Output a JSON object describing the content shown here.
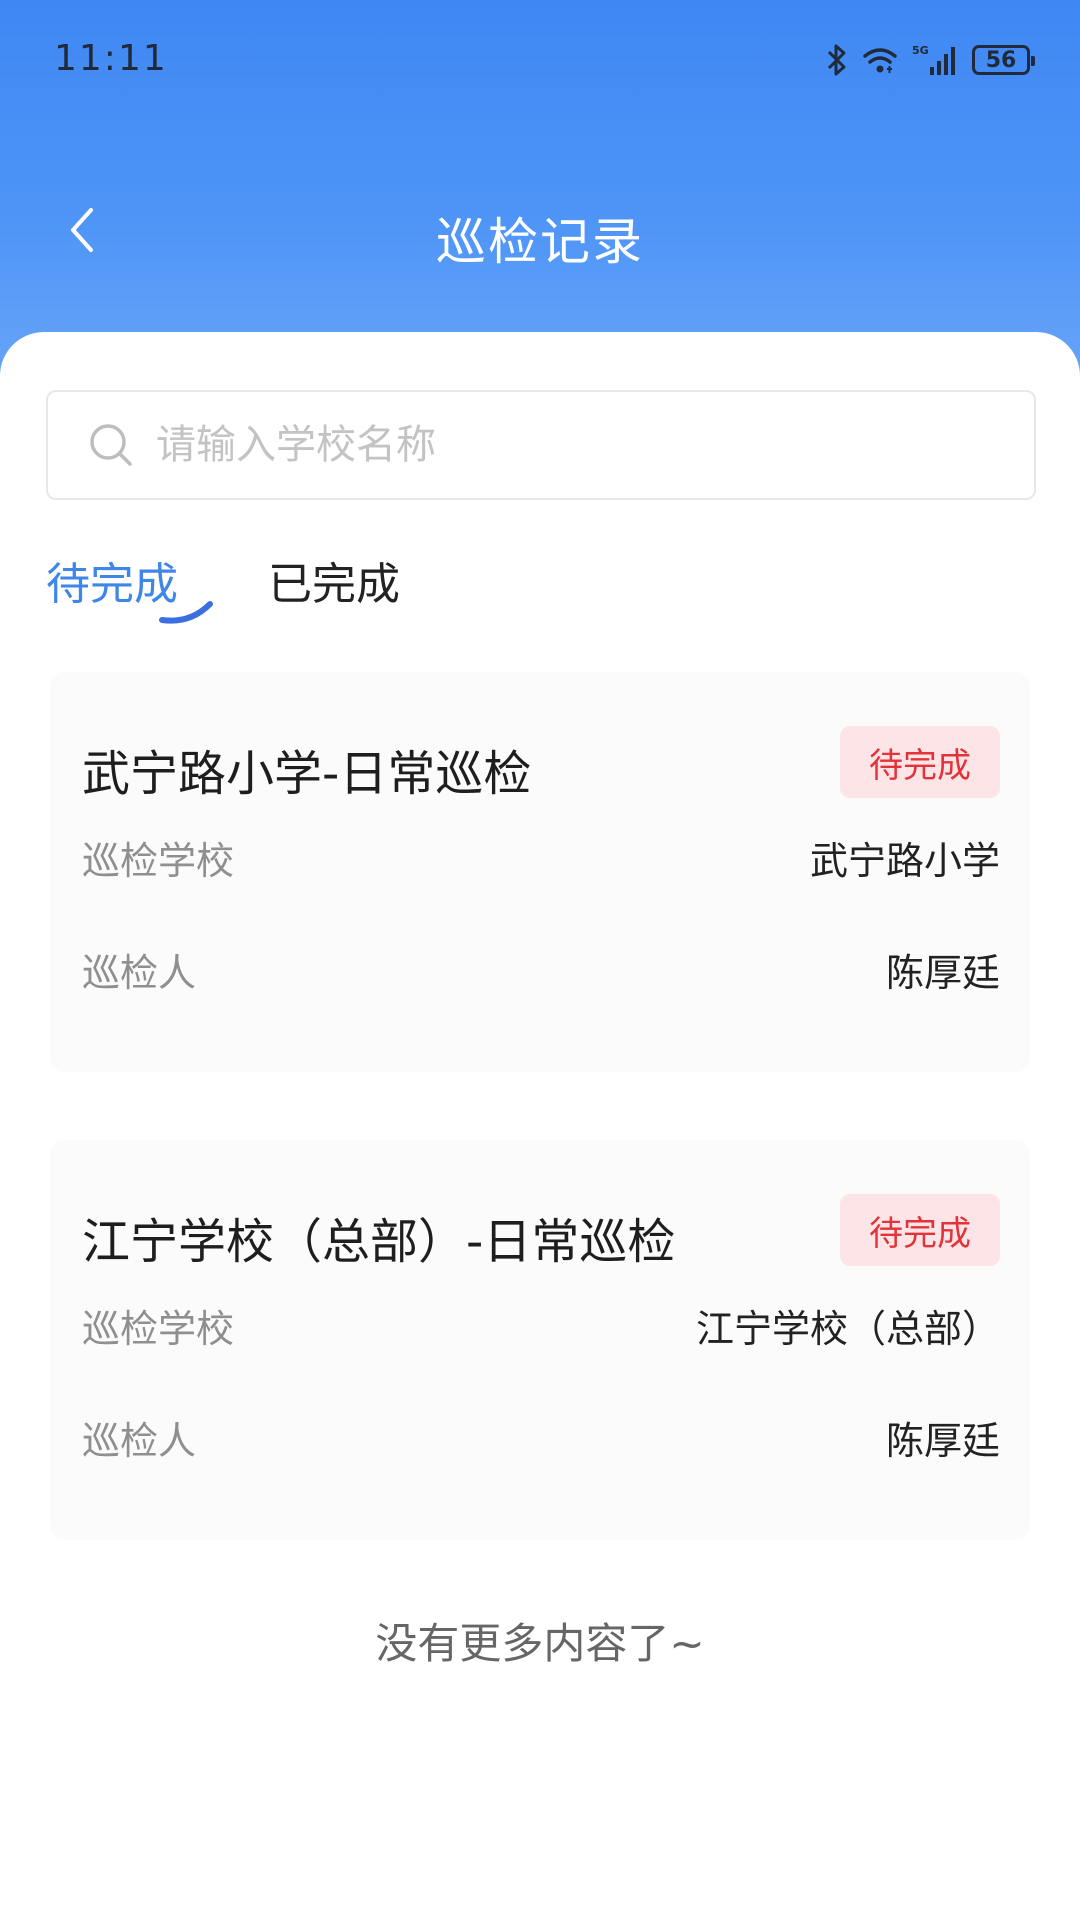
{
  "status_bar": {
    "time": "11:11",
    "network": "5G",
    "battery": "56"
  },
  "header": {
    "title": "巡检记录"
  },
  "search": {
    "placeholder": "请输入学校名称"
  },
  "tabs": [
    {
      "label": "待完成",
      "active": true
    },
    {
      "label": "已完成",
      "active": false
    }
  ],
  "records": [
    {
      "title": "武宁路小学-日常巡检",
      "status": "待完成",
      "school_label": "巡检学校",
      "school": "武宁路小学",
      "inspector_label": "巡检人",
      "inspector": "陈厚廷"
    },
    {
      "title": "江宁学校（总部）-日常巡检",
      "status": "待完成",
      "school_label": "巡检学校",
      "school": "江宁学校（总部）",
      "inspector_label": "巡检人",
      "inspector": "陈厚廷"
    }
  ],
  "footer": {
    "no_more": "没有更多内容了~"
  },
  "colors": {
    "header_gradient_start": "#3f87f3",
    "header_gradient_end": "#6aa6f8",
    "active_tab": "#3e86e8",
    "status_badge_bg": "#fde5e7",
    "status_badge_text": "#e2323a"
  }
}
